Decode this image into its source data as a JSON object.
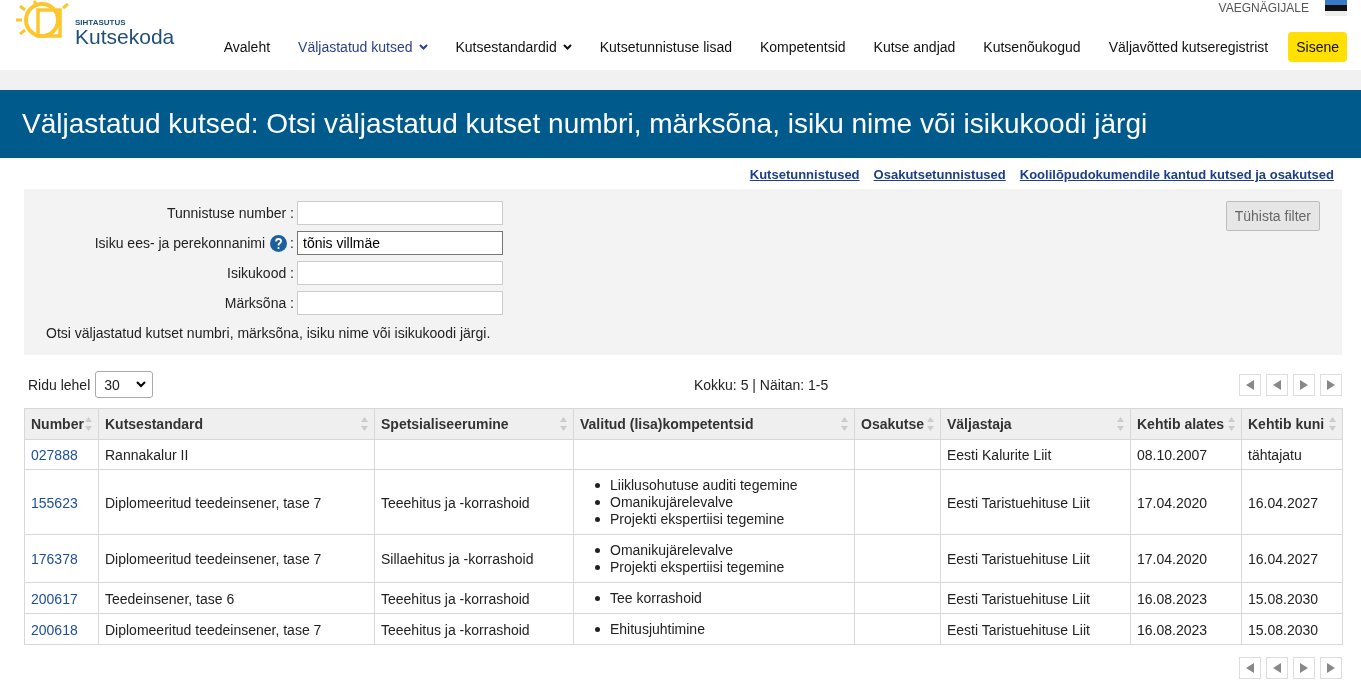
{
  "header": {
    "logo": {
      "tagline": "SIHTASUTUS",
      "name": "Kutsekoda"
    },
    "accessibility_link": "VAEGNÄGIJALE",
    "nav": [
      {
        "label": "Avaleht",
        "selected": false,
        "dropdown": false
      },
      {
        "label": "Väljastatud kutsed",
        "selected": true,
        "dropdown": true
      },
      {
        "label": "Kutsestandardid",
        "selected": false,
        "dropdown": true
      },
      {
        "label": "Kutsetunnistuse lisad",
        "selected": false,
        "dropdown": false
      },
      {
        "label": "Kompetentsid",
        "selected": false,
        "dropdown": false
      },
      {
        "label": "Kutse andjad",
        "selected": false,
        "dropdown": false
      },
      {
        "label": "Kutsenõukogud",
        "selected": false,
        "dropdown": false
      },
      {
        "label": "Väljavõtted kutseregistrist",
        "selected": false,
        "dropdown": false
      }
    ],
    "login_button": "Sisene"
  },
  "banner": {
    "title": "Väljastatud kutsed: Otsi väljastatud kutset numbri, märksõna, isiku nime või isikukoodi järgi"
  },
  "links": [
    "Kutsetunnistused",
    "Osakutsetunnistused",
    "Koolilõpudokumendile kantud kutsed ja osakutsed"
  ],
  "filter": {
    "fields": [
      {
        "label": "Tunnistuse number :",
        "help": false,
        "focused": false
      },
      {
        "label": "Isiku ees- ja perekonnanimi",
        "help": true,
        "colon": ":",
        "value": "tõnis villmäe",
        "focused": true
      },
      {
        "label": "Isikukood :",
        "help": false,
        "focused": false
      },
      {
        "label": "Märksõna :",
        "help": false,
        "focused": false
      }
    ],
    "hint": "Otsi väljastatud kutset numbri, märksõna, isiku nime või isikukoodi järgi.",
    "clear_button": "Tühista filter"
  },
  "pager": {
    "rows_label": "Ridu lehel",
    "rows_value": "30",
    "summary": "Kokku: 5 | Näitan: 1-5"
  },
  "table": {
    "columns": [
      "Number",
      "Kutsestandard",
      "Spetsialiseerumine",
      "Valitud (lisa)kompetentsid",
      "Osakutse",
      "Väljastaja",
      "Kehtib alates",
      "Kehtib kuni"
    ],
    "rows": [
      {
        "number": "027888",
        "standard": "Rannakalur II",
        "specialization": "",
        "competences": [],
        "partial": "",
        "issuer": "Eesti Kalurite Liit",
        "valid_from": "08.10.2007",
        "valid_to": "tähtajatu"
      },
      {
        "number": "155623",
        "standard": "Diplomeeritud teedeinsener, tase 7",
        "specialization": "Teeehitus ja -korrashoid",
        "competences": [
          "Liiklusohutuse auditi tegemine",
          "Omanikujärelevalve",
          "Projekti ekspertiisi tegemine"
        ],
        "partial": "",
        "issuer": "Eesti Taristuehituse Liit",
        "valid_from": "17.04.2020",
        "valid_to": "16.04.2027"
      },
      {
        "number": "176378",
        "standard": "Diplomeeritud teedeinsener, tase 7",
        "specialization": "Sillaehitus ja -korrashoid",
        "competences": [
          "Omanikujärelevalve",
          "Projekti ekspertiisi tegemine"
        ],
        "partial": "",
        "issuer": "Eesti Taristuehituse Liit",
        "valid_from": "17.04.2020",
        "valid_to": "16.04.2027"
      },
      {
        "number": "200617",
        "standard": "Teedeinsener, tase 6",
        "specialization": "Teeehitus ja -korrashoid",
        "competences": [
          "Tee korrashoid"
        ],
        "partial": "",
        "issuer": "Eesti Taristuehituse Liit",
        "valid_from": "16.08.2023",
        "valid_to": "15.08.2030"
      },
      {
        "number": "200618",
        "standard": "Diplomeeritud teedeinsener, tase 7",
        "specialization": "Teeehitus ja -korrashoid",
        "competences": [
          "Ehitusjuhtimine"
        ],
        "partial": "",
        "issuer": "Eesti Taristuehituse Liit",
        "valid_from": "16.08.2023",
        "valid_to": "15.08.2030"
      }
    ]
  }
}
